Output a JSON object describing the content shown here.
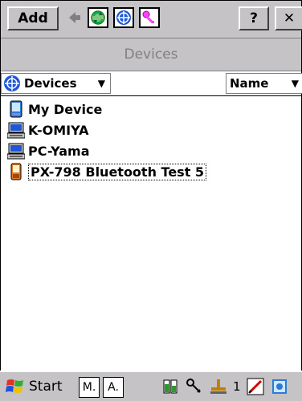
{
  "toolbar": {
    "add_label": "Add",
    "help_label": "?",
    "close_label": "✕"
  },
  "window": {
    "title": "Devices"
  },
  "selector": {
    "selected": "Devices",
    "sort_label": "Name"
  },
  "devices": [
    {
      "label": "My Device",
      "icon": "pda-icon"
    },
    {
      "label": "K-OMIYA",
      "icon": "computer-icon"
    },
    {
      "label": "PC-Yama",
      "icon": "computer-icon"
    },
    {
      "label": "PX-798 Bluetooth Test 5",
      "icon": "phone-icon",
      "selected": true
    }
  ],
  "taskbar": {
    "start_label": "Start",
    "task_m": "M.",
    "task_a": "A.",
    "tray_number": "1"
  },
  "colors": {
    "chrome": "#c6c3c6",
    "title_text": "#808080",
    "accent": "#0000ff"
  }
}
